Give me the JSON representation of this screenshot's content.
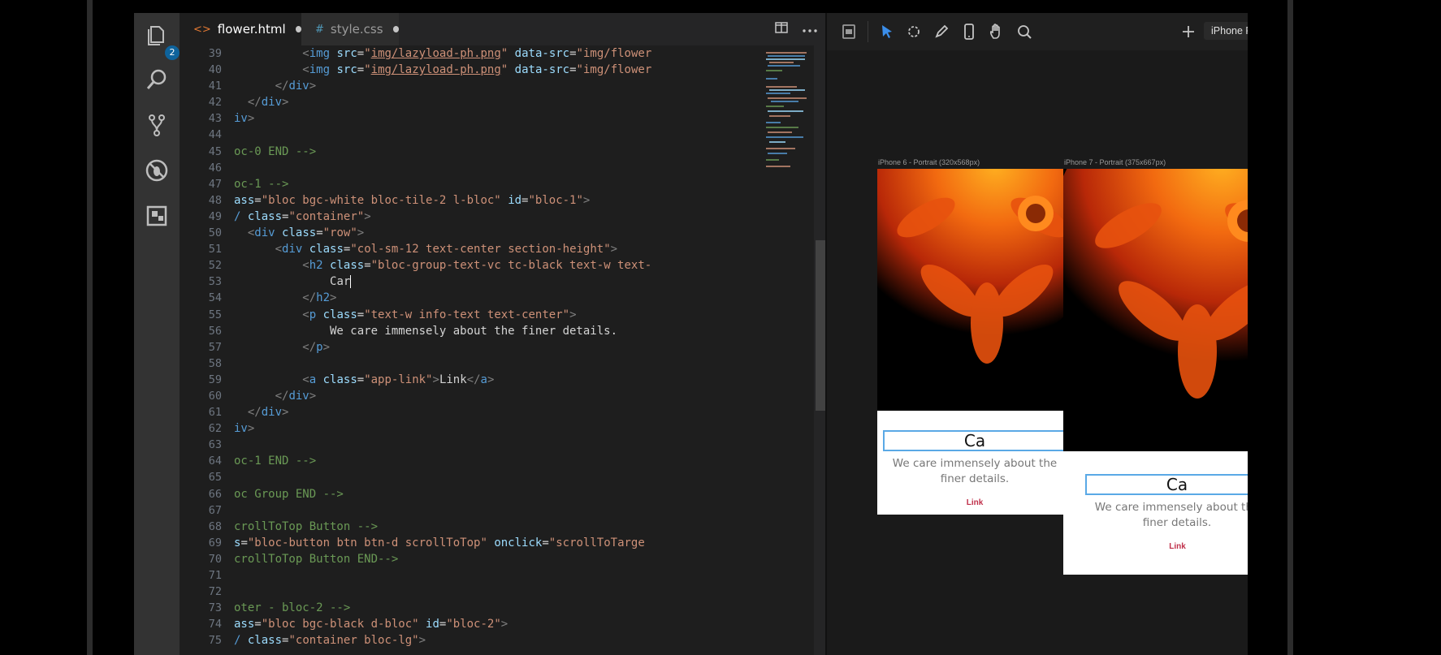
{
  "editor": {
    "tabs": [
      {
        "icon": "<>",
        "label": "flower.html",
        "active": true,
        "dirty": true
      },
      {
        "icon": "#",
        "label": "style.css",
        "active": false,
        "dirty": true
      }
    ],
    "explorer_badge": "2",
    "line_numbers": [
      "39",
      "40",
      "41",
      "42",
      "43",
      "44",
      "45",
      "46",
      "47",
      "48",
      "49",
      "50",
      "51",
      "52",
      "53",
      "54",
      "55",
      "56",
      "57",
      "58",
      "59",
      "60",
      "61",
      "62",
      "63",
      "64",
      "65",
      "66",
      "67",
      "68",
      "69",
      "70",
      "71",
      "72",
      "73",
      "74",
      "75"
    ],
    "typed_text": "Car"
  },
  "preview": {
    "device_select": {
      "value": "iPhone Portrait"
    },
    "devices": [
      {
        "label": "iPhone 6 - Portrait (320x568px)",
        "heading": "Ca",
        "text": "We care immensely about the finer details.",
        "link": "Link"
      },
      {
        "label": "iPhone 7 - Portrait (375x667px)",
        "heading": "Ca",
        "text": "We care immensely about the finer details.",
        "link": "Link"
      }
    ]
  },
  "colors": {
    "accent": "#0e639c",
    "selection_outline": "#5aa9e6",
    "link": "#c0304a"
  }
}
